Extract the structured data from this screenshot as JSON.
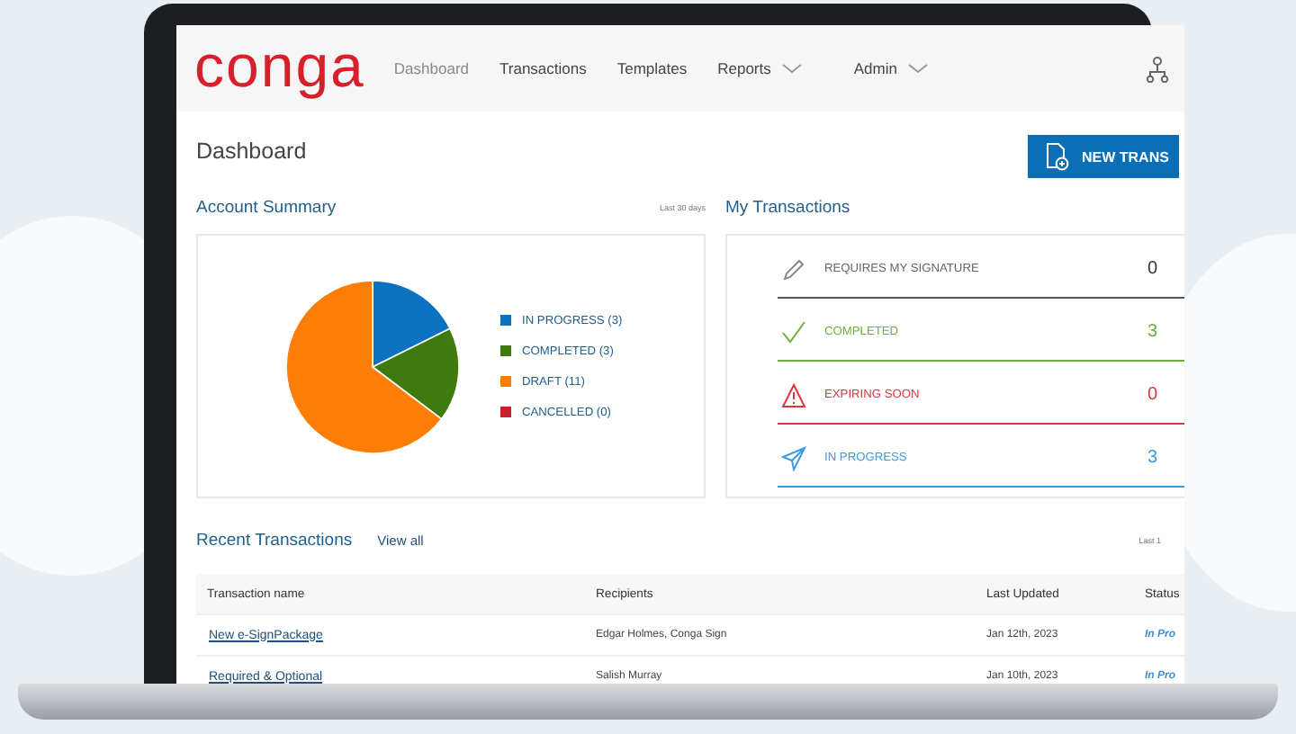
{
  "nav": {
    "logo": "conga",
    "items": [
      {
        "label": "Dashboard",
        "selected": true,
        "has_menu": false
      },
      {
        "label": "Transactions",
        "selected": false,
        "has_menu": false
      },
      {
        "label": "Templates",
        "selected": false,
        "has_menu": false
      },
      {
        "label": "Reports",
        "selected": false,
        "has_menu": true
      },
      {
        "label": "Admin",
        "selected": false,
        "has_menu": true
      }
    ]
  },
  "page": {
    "title": "Dashboard",
    "new_button": "NEW TRANS"
  },
  "account_summary": {
    "title": "Account Summary",
    "period": "Last 30 days",
    "chart_data": {
      "type": "pie",
      "categories": [
        "IN PROGRESS (3)",
        "COMPLETED (3)",
        "DRAFT (11)",
        "CANCELLED (0)"
      ],
      "values": [
        3,
        3,
        11,
        0
      ],
      "legend": "right",
      "colors": [
        "#0a72c0",
        "#3f7a0e",
        "#fd7e07",
        "#c8202c"
      ]
    }
  },
  "my_transactions": {
    "title": "My Transactions",
    "rows": [
      {
        "kind": "signature",
        "label": "REQUIRES MY SIGNATURE",
        "count": "0",
        "color": "#555555"
      },
      {
        "kind": "completed",
        "label": "COMPLETED",
        "count": "3",
        "color": "#6fae3b"
      },
      {
        "kind": "expiring",
        "label": "EXPIRING SOON",
        "count": "0",
        "color": "#e0353f"
      },
      {
        "kind": "progress",
        "label": "IN PROGRESS",
        "count": "3",
        "color": "#3d9ae0"
      }
    ]
  },
  "recent_transactions": {
    "title": "Recent Transactions",
    "view_all": "View all",
    "period": "Last 1",
    "table": {
      "columns": [
        "Transaction name",
        "Recipients",
        "Last Updated",
        "Status"
      ],
      "rows": [
        [
          "New e-SignPackage",
          "Edgar Holmes, Conga Sign",
          "Jan 12th, 2023",
          "In Pro"
        ],
        [
          "Required & Optional",
          "Salish Murray",
          "Jan 10th, 2023",
          "In Pro"
        ]
      ]
    }
  }
}
